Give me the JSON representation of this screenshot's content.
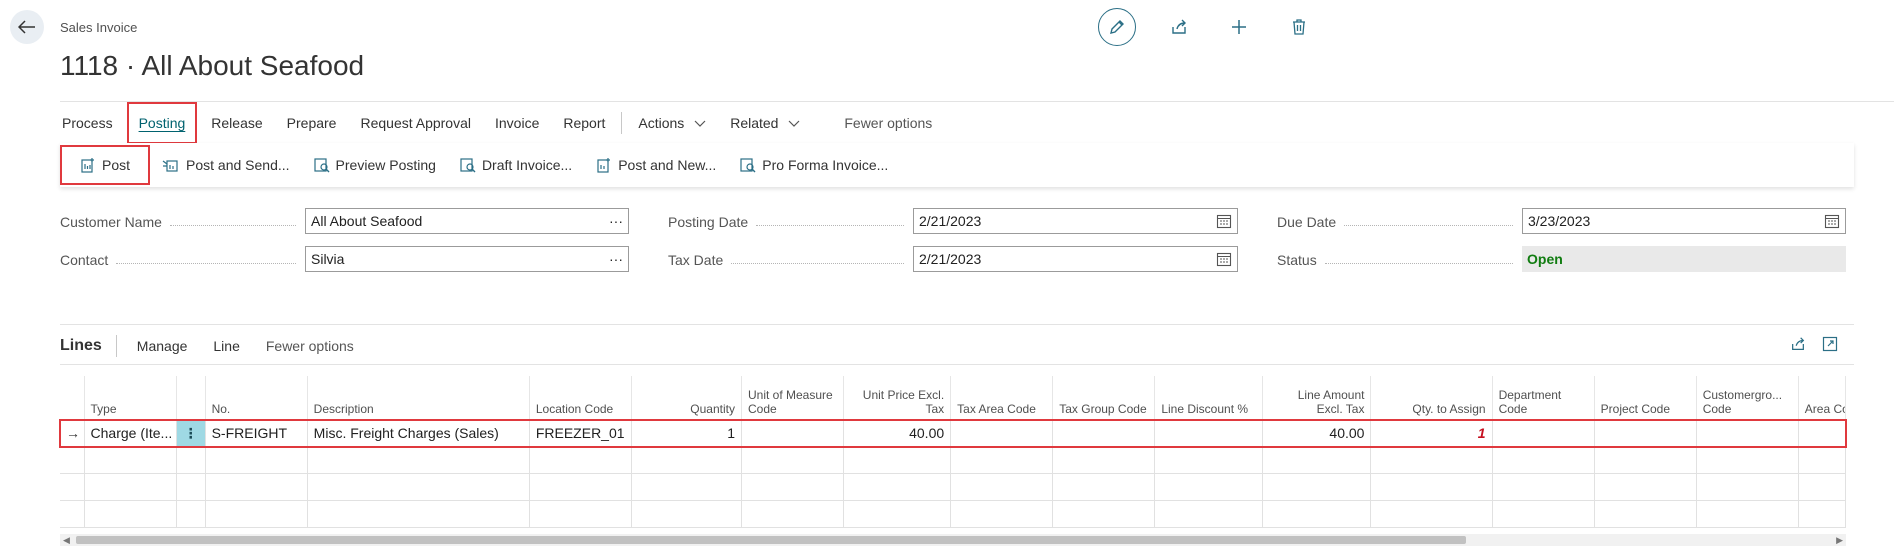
{
  "header": {
    "breadcrumb": "Sales Invoice",
    "title": "1118 · All About Seafood"
  },
  "menu": {
    "items": [
      "Process",
      "Posting",
      "Release",
      "Prepare",
      "Request Approval",
      "Invoice",
      "Report"
    ],
    "actions": "Actions",
    "related": "Related",
    "fewer": "Fewer options"
  },
  "posting_actions": [
    "Post",
    "Post and Send...",
    "Preview Posting",
    "Draft Invoice...",
    "Post and New...",
    "Pro Forma Invoice..."
  ],
  "fields": {
    "customer_name_label": "Customer Name",
    "customer_name": "All About Seafood",
    "contact_label": "Contact",
    "contact": "Silvia",
    "posting_date_label": "Posting Date",
    "posting_date": "2/21/2023",
    "tax_date_label": "Tax Date",
    "tax_date": "2/21/2023",
    "due_date_label": "Due Date",
    "due_date": "3/23/2023",
    "status_label": "Status",
    "status": "Open",
    "lookup": "···"
  },
  "lines": {
    "title": "Lines",
    "tabs": [
      "Manage",
      "Line",
      "Fewer options"
    ],
    "columns": [
      "Type",
      "No.",
      "Description",
      "Location Code",
      "Quantity",
      "Unit of Measure Code",
      "Unit Price Excl. Tax",
      "Tax Area Code",
      "Tax Group Code",
      "Line Discount %",
      "Line Amount Excl. Tax",
      "Qty. to Assign",
      "Department Code",
      "Project Code",
      "Customergro... Code",
      "Area Co..."
    ],
    "row": {
      "marker": "→",
      "type": "Charge (Ite...",
      "menu": "⋮",
      "no": "S-FREIGHT",
      "description": "Misc. Freight Charges (Sales)",
      "location": "FREEZER_01",
      "quantity": "1",
      "unit_price": "40.00",
      "line_amount": "40.00",
      "qty_to_assign": "1"
    }
  },
  "colors": {
    "accent": "#00626f",
    "highlight": "#e0393e",
    "status_open": "#107c10"
  }
}
